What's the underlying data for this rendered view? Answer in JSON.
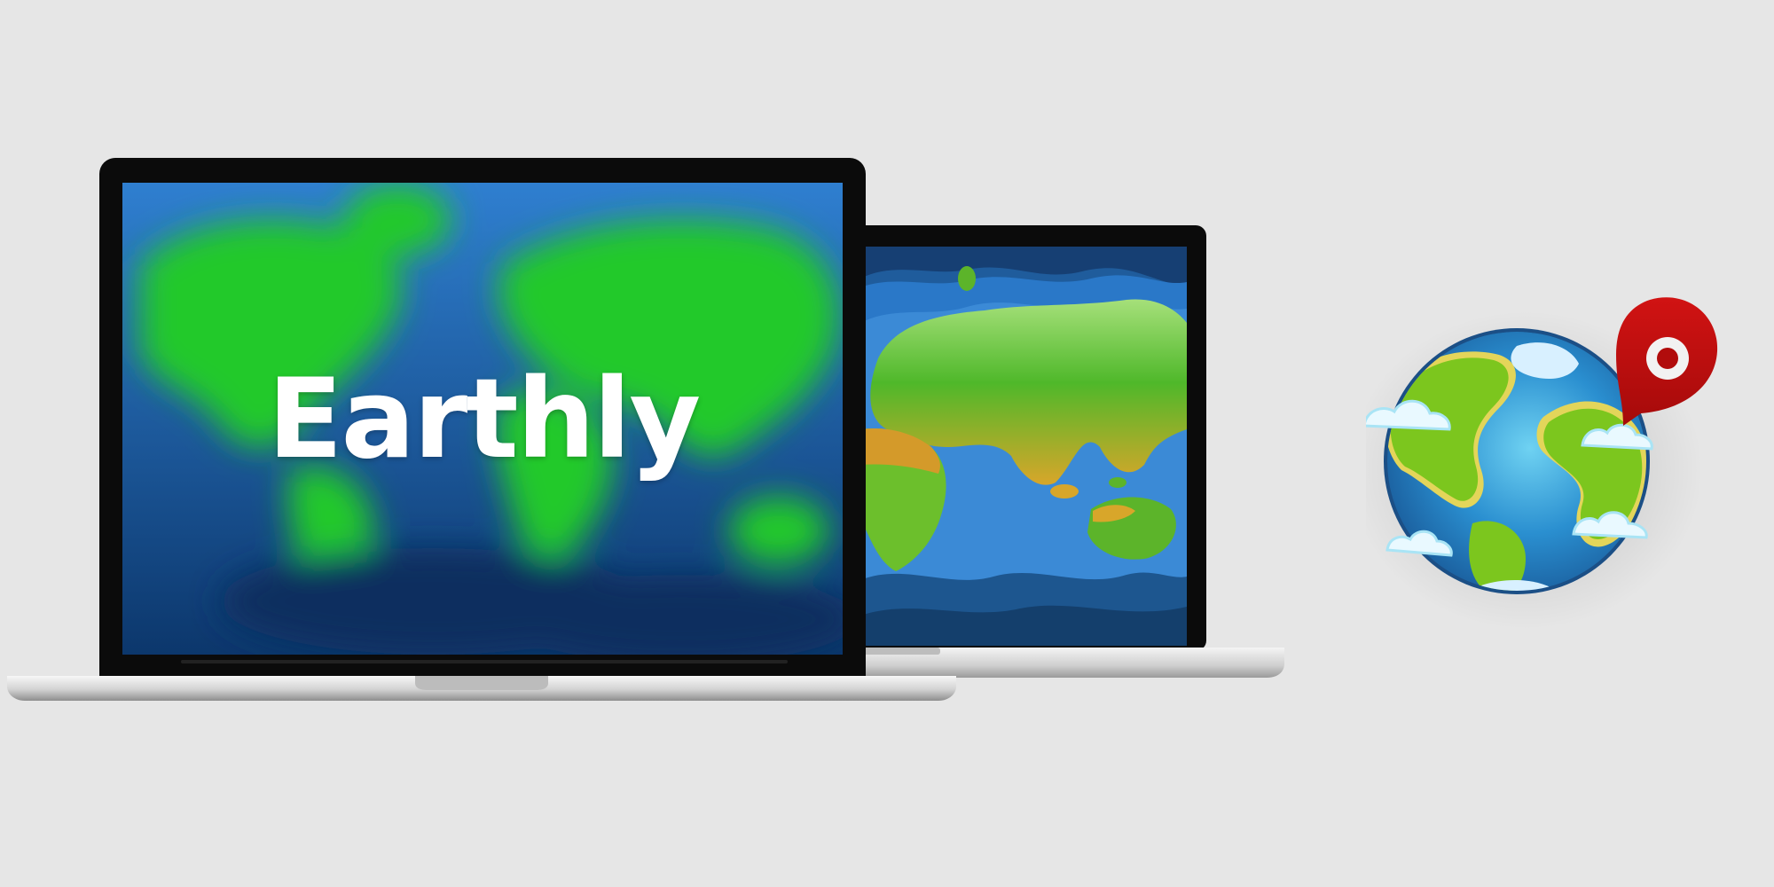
{
  "app": {
    "name": "Earthly",
    "icon": "globe-location-pin-icon"
  },
  "devices": {
    "front": {
      "label": "laptop-front",
      "screen_content": "blurred-world-map"
    },
    "back": {
      "label": "laptop-back",
      "screen_content": "layered-paper-world-map"
    }
  },
  "colors": {
    "background": "#e6e6e6",
    "ocean_deep": "#0d3f7a",
    "ocean": "#2a6fbe",
    "land": "#25c12a",
    "land_dry": "#c99a24",
    "pin": "#c00d0d",
    "bezel": "#0b0b0b",
    "aluminum": "#d7d7d7"
  }
}
